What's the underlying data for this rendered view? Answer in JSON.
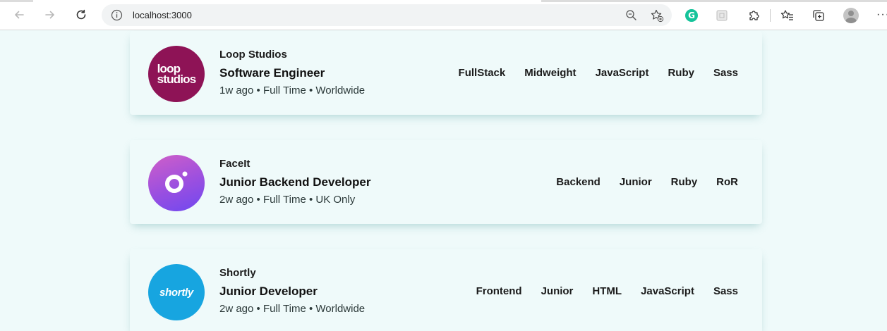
{
  "browser": {
    "url": "localhost:3000"
  },
  "jobs": [
    {
      "company": "Loop Studios",
      "logo_text": "loop studios",
      "logo_lines": [
        "loop",
        "studios"
      ],
      "position": "Software Engineer",
      "meta": "1w ago • Full Time • Worldwide",
      "tags": [
        "FullStack",
        "Midweight",
        "JavaScript",
        "Ruby",
        "Sass"
      ],
      "logo_color": "#8e1356"
    },
    {
      "company": "FaceIt",
      "position": "Junior Backend Developer",
      "meta": "2w ago • Full Time • UK Only",
      "tags": [
        "Backend",
        "Junior",
        "Ruby",
        "RoR"
      ],
      "logo_color": "#9a4fe0"
    },
    {
      "company": "Shortly",
      "logo_text": "shortly",
      "position": "Junior Developer",
      "meta": "2w ago • Full Time • Worldwide",
      "tags": [
        "Frontend",
        "Junior",
        "HTML",
        "JavaScript",
        "Sass"
      ],
      "logo_color": "#17a5e0"
    }
  ],
  "colors": {
    "background": "#effafa",
    "text_dark": "#1b1b1b"
  }
}
